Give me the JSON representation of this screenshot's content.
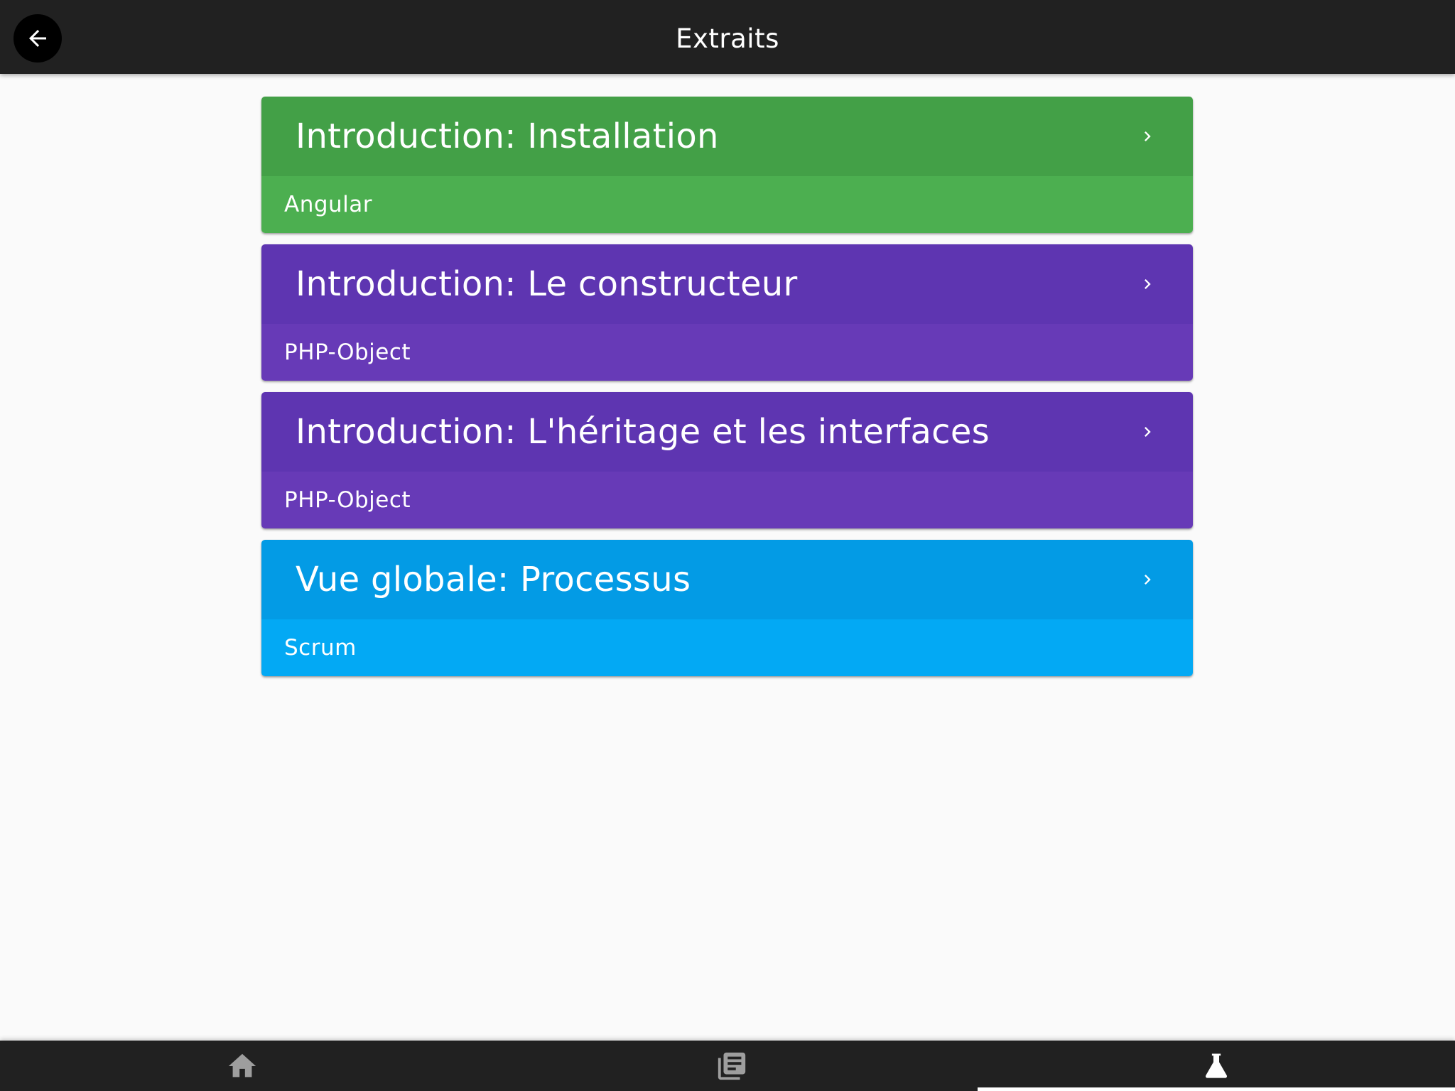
{
  "app_bar": {
    "title": "Extraits",
    "back_icon": "arrow-left-icon"
  },
  "cards": [
    {
      "title": "Introduction: Installation",
      "subtitle": "Angular",
      "header_color": "#43a047",
      "footer_color": "#4caf50"
    },
    {
      "title": "Introduction: Le constructeur",
      "subtitle": "PHP-Object",
      "header_color": "#5e35b1",
      "footer_color": "#673ab7"
    },
    {
      "title": "Introduction: L'héritage et les interfaces",
      "subtitle": "PHP-Object",
      "header_color": "#5e35b1",
      "footer_color": "#673ab7"
    },
    {
      "title": "Vue globale: Processus",
      "subtitle": "Scrum",
      "header_color": "#039be5",
      "footer_color": "#03a9f4"
    }
  ],
  "bottom_nav": {
    "items": [
      {
        "icon": "home-icon",
        "color": "#9e9e9e",
        "active": false
      },
      {
        "icon": "article-icon",
        "color": "#9e9e9e",
        "active": false
      },
      {
        "icon": "flask-icon",
        "color": "#ffffff",
        "active": true
      }
    ],
    "indicator_color": "#ffffff"
  },
  "colors": {
    "app_bar": "#212121",
    "background": "#fafafa",
    "bottom_nav": "#212121"
  }
}
